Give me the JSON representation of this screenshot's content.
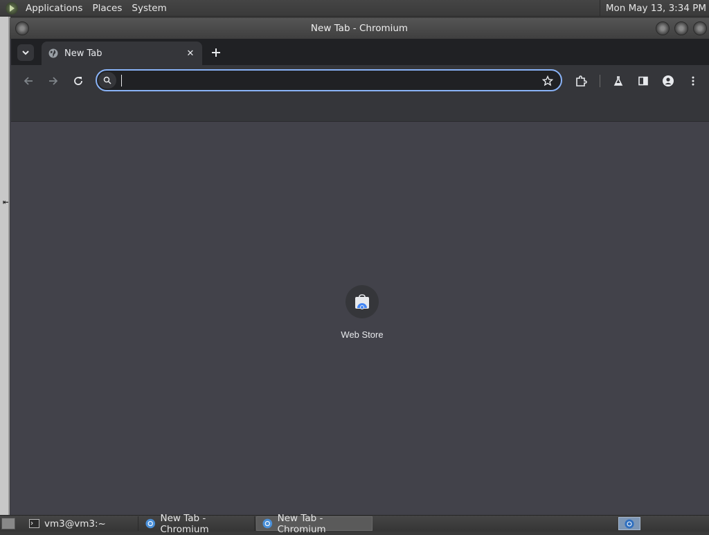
{
  "top_panel": {
    "menus": [
      "Applications",
      "Places",
      "System"
    ],
    "clock": "Mon May 13,  3:34 PM"
  },
  "window": {
    "title": "New Tab - Chromium"
  },
  "browser": {
    "tab": {
      "title": "New Tab"
    },
    "omnibox": {
      "value": "",
      "placeholder": ""
    },
    "accent_color": "#8ab4f8"
  },
  "new_tab_page": {
    "shortcuts": [
      {
        "label": "Web Store",
        "icon": "webstore-icon"
      }
    ]
  },
  "taskbar": {
    "tasks": [
      {
        "label": "vm3@vm3:~",
        "icon": "terminal-icon",
        "active": false
      },
      {
        "label": "New Tab - Chromium",
        "icon": "chromium-icon",
        "active": false
      },
      {
        "label": "New Tab - Chromium",
        "icon": "chromium-icon",
        "active": true
      }
    ]
  }
}
